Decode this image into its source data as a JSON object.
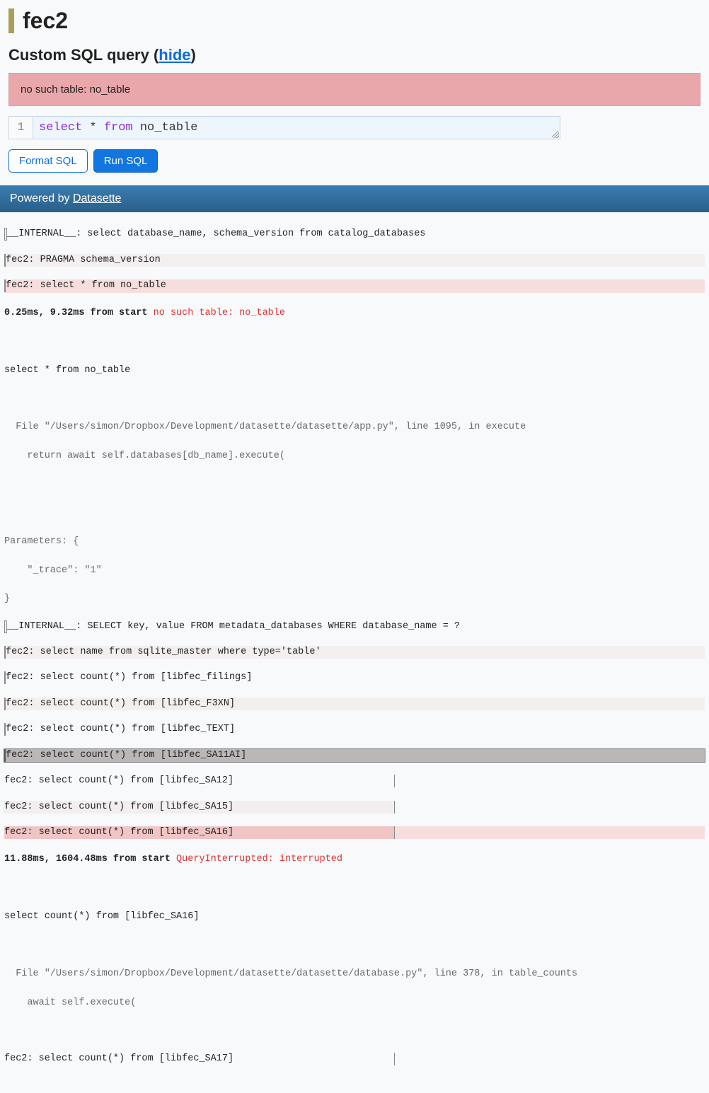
{
  "header": {
    "title": "fec2",
    "subtitle_prefix": "Custom SQL query (",
    "hide_link": "hide",
    "subtitle_suffix": ")"
  },
  "error": {
    "text": "no such table: no_table"
  },
  "editor": {
    "line_no": "1",
    "kw_select": "select",
    "star": "*",
    "kw_from": "from",
    "table": "no_table"
  },
  "buttons": {
    "format": "Format SQL",
    "run": "Run SQL"
  },
  "footer": {
    "prefix": "Powered by ",
    "link": "Datasette"
  },
  "trace": {
    "l01": "__INTERNAL__: select database_name, schema_version from catalog_databases",
    "l02": "fec2: PRAGMA schema_version",
    "l03": "fec2: select * from no_table",
    "l04a": "0.25ms, 9.32ms from start ",
    "l04b": "no such table: no_table",
    "l05": "select * from no_table",
    "l06": "  File \"/Users/simon/Dropbox/Development/datasette/datasette/app.py\", line 1095, in execute",
    "l07": "    return await self.databases[db_name].execute(",
    "l08": "Parameters: {",
    "l09": "    \"_trace\": \"1\"",
    "l10": "}",
    "l11": "__INTERNAL__: SELECT key, value FROM metadata_databases WHERE database_name = ?",
    "l12": "fec2: select name from sqlite_master where type='table'",
    "l13": "fec2: select count(*) from [libfec_filings]",
    "l14": "fec2: select count(*) from [libfec_F3XN]",
    "l15": "fec2: select count(*) from [libfec_TEXT]",
    "l16": "fec2: select count(*) from [libfec_SA11AI]",
    "l17": "fec2: select count(*) from [libfec_SA12]",
    "l18": "fec2: select count(*) from [libfec_SA15]",
    "l19": "fec2: select count(*) from [libfec_SA16]",
    "l20a": "11.88ms, 1604.48ms from start ",
    "l20b": "QueryInterrupted: interrupted",
    "l21": "select count(*) from [libfec_SA16]",
    "l22": "  File \"/Users/simon/Dropbox/Development/datasette/datasette/database.py\", line 378, in table_counts",
    "l23": "    await self.execute(",
    "l24": "fec2: select count(*) from [libfec_SA17]"
  }
}
